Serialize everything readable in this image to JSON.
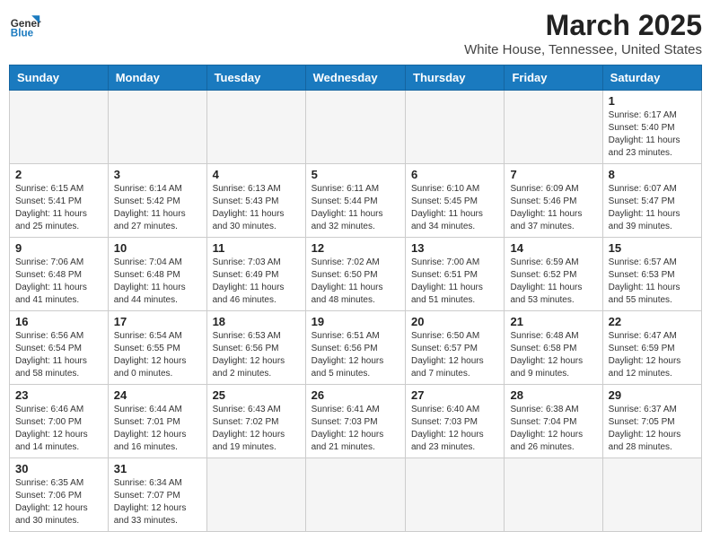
{
  "header": {
    "logo_general": "General",
    "logo_blue": "Blue",
    "month_title": "March 2025",
    "subtitle": "White House, Tennessee, United States"
  },
  "weekdays": [
    "Sunday",
    "Monday",
    "Tuesday",
    "Wednesday",
    "Thursday",
    "Friday",
    "Saturday"
  ],
  "days": [
    {
      "num": "",
      "info": ""
    },
    {
      "num": "",
      "info": ""
    },
    {
      "num": "",
      "info": ""
    },
    {
      "num": "",
      "info": ""
    },
    {
      "num": "",
      "info": ""
    },
    {
      "num": "",
      "info": ""
    },
    {
      "num": "1",
      "info": "Sunrise: 6:17 AM\nSunset: 5:40 PM\nDaylight: 11 hours\nand 23 minutes."
    },
    {
      "num": "2",
      "info": "Sunrise: 6:15 AM\nSunset: 5:41 PM\nDaylight: 11 hours\nand 25 minutes."
    },
    {
      "num": "3",
      "info": "Sunrise: 6:14 AM\nSunset: 5:42 PM\nDaylight: 11 hours\nand 27 minutes."
    },
    {
      "num": "4",
      "info": "Sunrise: 6:13 AM\nSunset: 5:43 PM\nDaylight: 11 hours\nand 30 minutes."
    },
    {
      "num": "5",
      "info": "Sunrise: 6:11 AM\nSunset: 5:44 PM\nDaylight: 11 hours\nand 32 minutes."
    },
    {
      "num": "6",
      "info": "Sunrise: 6:10 AM\nSunset: 5:45 PM\nDaylight: 11 hours\nand 34 minutes."
    },
    {
      "num": "7",
      "info": "Sunrise: 6:09 AM\nSunset: 5:46 PM\nDaylight: 11 hours\nand 37 minutes."
    },
    {
      "num": "8",
      "info": "Sunrise: 6:07 AM\nSunset: 5:47 PM\nDaylight: 11 hours\nand 39 minutes."
    },
    {
      "num": "9",
      "info": "Sunrise: 7:06 AM\nSunset: 6:48 PM\nDaylight: 11 hours\nand 41 minutes."
    },
    {
      "num": "10",
      "info": "Sunrise: 7:04 AM\nSunset: 6:48 PM\nDaylight: 11 hours\nand 44 minutes."
    },
    {
      "num": "11",
      "info": "Sunrise: 7:03 AM\nSunset: 6:49 PM\nDaylight: 11 hours\nand 46 minutes."
    },
    {
      "num": "12",
      "info": "Sunrise: 7:02 AM\nSunset: 6:50 PM\nDaylight: 11 hours\nand 48 minutes."
    },
    {
      "num": "13",
      "info": "Sunrise: 7:00 AM\nSunset: 6:51 PM\nDaylight: 11 hours\nand 51 minutes."
    },
    {
      "num": "14",
      "info": "Sunrise: 6:59 AM\nSunset: 6:52 PM\nDaylight: 11 hours\nand 53 minutes."
    },
    {
      "num": "15",
      "info": "Sunrise: 6:57 AM\nSunset: 6:53 PM\nDaylight: 11 hours\nand 55 minutes."
    },
    {
      "num": "16",
      "info": "Sunrise: 6:56 AM\nSunset: 6:54 PM\nDaylight: 11 hours\nand 58 minutes."
    },
    {
      "num": "17",
      "info": "Sunrise: 6:54 AM\nSunset: 6:55 PM\nDaylight: 12 hours\nand 0 minutes."
    },
    {
      "num": "18",
      "info": "Sunrise: 6:53 AM\nSunset: 6:56 PM\nDaylight: 12 hours\nand 2 minutes."
    },
    {
      "num": "19",
      "info": "Sunrise: 6:51 AM\nSunset: 6:56 PM\nDaylight: 12 hours\nand 5 minutes."
    },
    {
      "num": "20",
      "info": "Sunrise: 6:50 AM\nSunset: 6:57 PM\nDaylight: 12 hours\nand 7 minutes."
    },
    {
      "num": "21",
      "info": "Sunrise: 6:48 AM\nSunset: 6:58 PM\nDaylight: 12 hours\nand 9 minutes."
    },
    {
      "num": "22",
      "info": "Sunrise: 6:47 AM\nSunset: 6:59 PM\nDaylight: 12 hours\nand 12 minutes."
    },
    {
      "num": "23",
      "info": "Sunrise: 6:46 AM\nSunset: 7:00 PM\nDaylight: 12 hours\nand 14 minutes."
    },
    {
      "num": "24",
      "info": "Sunrise: 6:44 AM\nSunset: 7:01 PM\nDaylight: 12 hours\nand 16 minutes."
    },
    {
      "num": "25",
      "info": "Sunrise: 6:43 AM\nSunset: 7:02 PM\nDaylight: 12 hours\nand 19 minutes."
    },
    {
      "num": "26",
      "info": "Sunrise: 6:41 AM\nSunset: 7:03 PM\nDaylight: 12 hours\nand 21 minutes."
    },
    {
      "num": "27",
      "info": "Sunrise: 6:40 AM\nSunset: 7:03 PM\nDaylight: 12 hours\nand 23 minutes."
    },
    {
      "num": "28",
      "info": "Sunrise: 6:38 AM\nSunset: 7:04 PM\nDaylight: 12 hours\nand 26 minutes."
    },
    {
      "num": "29",
      "info": "Sunrise: 6:37 AM\nSunset: 7:05 PM\nDaylight: 12 hours\nand 28 minutes."
    },
    {
      "num": "30",
      "info": "Sunrise: 6:35 AM\nSunset: 7:06 PM\nDaylight: 12 hours\nand 30 minutes."
    },
    {
      "num": "31",
      "info": "Sunrise: 6:34 AM\nSunset: 7:07 PM\nDaylight: 12 hours\nand 33 minutes."
    },
    {
      "num": "",
      "info": ""
    },
    {
      "num": "",
      "info": ""
    },
    {
      "num": "",
      "info": ""
    },
    {
      "num": "",
      "info": ""
    },
    {
      "num": "",
      "info": ""
    }
  ]
}
